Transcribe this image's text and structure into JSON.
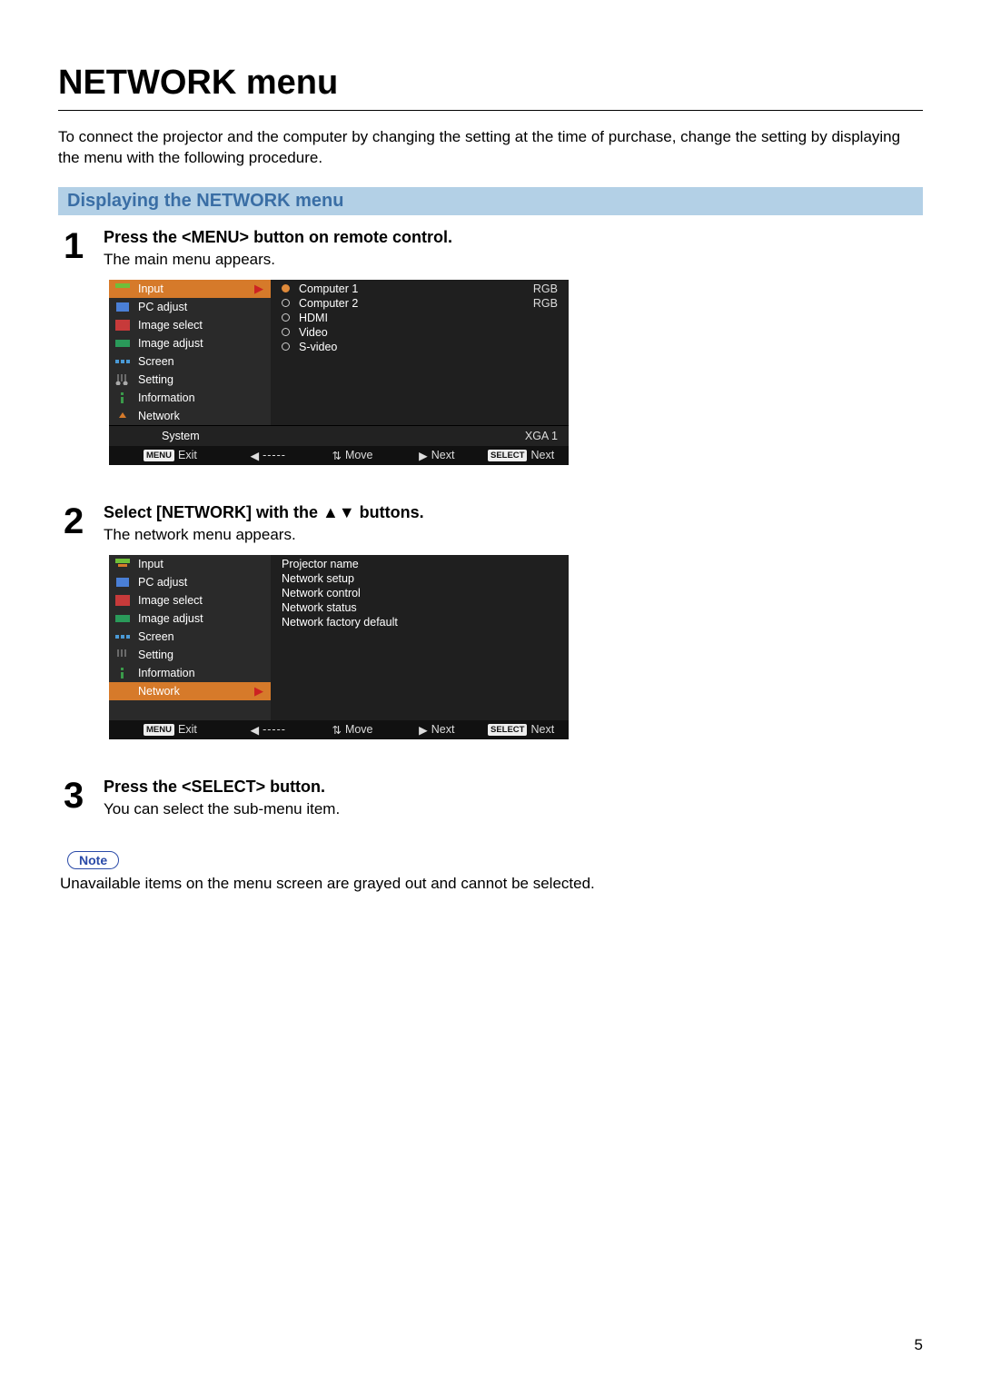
{
  "title": "NETWORK menu",
  "intro": "To connect the projector and the computer by changing the setting at the time of purchase, change the setting by displaying the menu with the following procedure.",
  "section_heading": "Displaying the NETWORK menu",
  "steps": [
    {
      "num": "1",
      "title": "Press the <MENU> button on remote control.",
      "desc": "The main menu appears."
    },
    {
      "num": "2",
      "title": "Select [NETWORK] with the ▲▼ buttons.",
      "desc": "The network menu appears."
    },
    {
      "num": "3",
      "title": "Press the <SELECT> button.",
      "desc": "You can select the sub-menu item."
    }
  ],
  "left_menu": {
    "items": [
      {
        "label": "Input"
      },
      {
        "label": "PC adjust"
      },
      {
        "label": "Image select"
      },
      {
        "label": "Image adjust"
      },
      {
        "label": "Screen"
      },
      {
        "label": "Setting"
      },
      {
        "label": "Information"
      },
      {
        "label": "Network"
      }
    ]
  },
  "osd1": {
    "right_items": [
      {
        "label": "Computer 1",
        "value": "RGB",
        "selected": true
      },
      {
        "label": "Computer 2",
        "value": "RGB"
      },
      {
        "label": "HDMI"
      },
      {
        "label": "Video"
      },
      {
        "label": "S-video"
      }
    ],
    "system_label": "System",
    "system_value": "XGA 1"
  },
  "osd2": {
    "right_items": [
      {
        "label": "Projector name"
      },
      {
        "label": "Network setup"
      },
      {
        "label": "Network control"
      },
      {
        "label": "Network status"
      },
      {
        "label": "Network factory default"
      }
    ]
  },
  "footer": {
    "menu_badge": "MENU",
    "exit": "Exit",
    "back_dashes": "-----",
    "move": "Move",
    "next": "Next",
    "select_badge": "SELECT",
    "select_next": "Next"
  },
  "note_label": "Note",
  "note_text": "Unavailable items on the menu screen are grayed out and cannot be selected.",
  "page_number": "5"
}
